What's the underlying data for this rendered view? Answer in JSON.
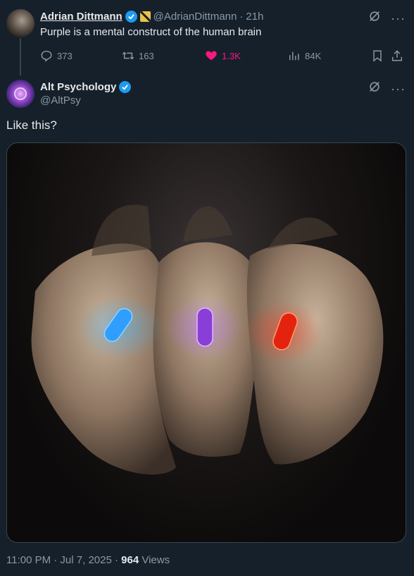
{
  "parent_tweet": {
    "author_name": "Adrian Dittmann",
    "handle": "@AdrianDittmann",
    "separator": "·",
    "time": "21h",
    "text": "Purple is a mental construct of the human brain",
    "stats": {
      "replies": "373",
      "reposts": "163",
      "likes": "1.3K",
      "views": "84K"
    }
  },
  "tweet": {
    "author_name": "Alt Psychology",
    "handle": "@AltPsy",
    "text": "Like this?",
    "time": "11:00 PM · Jul 7, 2025 · ",
    "views_count": "964",
    "views_label": " Views"
  },
  "icons": {
    "verified": "verified-badge-icon",
    "affiliate": "affiliate-badge-icon",
    "grok": "grok-icon",
    "more": "more-icon",
    "reply": "reply-icon",
    "repost": "repost-icon",
    "like": "heart-icon",
    "views": "analytics-icon",
    "bookmark": "bookmark-icon",
    "share": "share-icon"
  },
  "colors": {
    "background": "#15202b",
    "accent": "#1d9bf0",
    "like": "#f91880",
    "secondary_text": "#8b98a5"
  },
  "image": {
    "pills": [
      {
        "color": "blue",
        "hex": "#3fb2ff"
      },
      {
        "color": "purple",
        "hex": "#b46dff"
      },
      {
        "color": "red",
        "hex": "#ff3a1f"
      }
    ]
  }
}
